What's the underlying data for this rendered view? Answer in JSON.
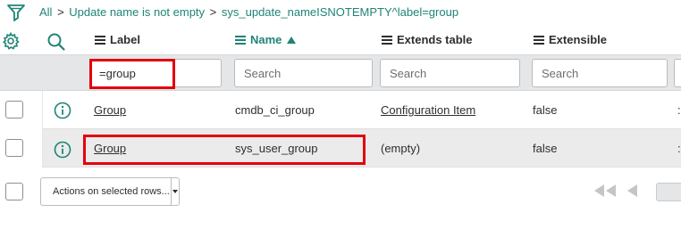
{
  "breadcrumb": {
    "all": "All",
    "sep1": ">",
    "crumb1": "Update name is not empty",
    "sep2": ">",
    "crumb2": "sys_update_nameISNOTEMPTY^label=group"
  },
  "header": {
    "columns": [
      {
        "label": "Label"
      },
      {
        "label": "Name"
      },
      {
        "label": "Extends table"
      },
      {
        "label": "Extensible"
      }
    ]
  },
  "search": {
    "label_value": "=group",
    "placeholder": "Search"
  },
  "rows": [
    {
      "label": "Group",
      "name": "cmdb_ci_group",
      "extends": "Configuration Item",
      "extensible": "false",
      "tail": ":"
    },
    {
      "label": "Group",
      "name": "sys_user_group",
      "extends": "(empty)",
      "extensible": "false",
      "tail": ":"
    }
  ],
  "footer": {
    "actions_label": "Actions on selected rows..."
  },
  "colors": {
    "link": "#1f8476",
    "highlight": "#e3000e",
    "search_row_bg": "#e4e6e7"
  }
}
